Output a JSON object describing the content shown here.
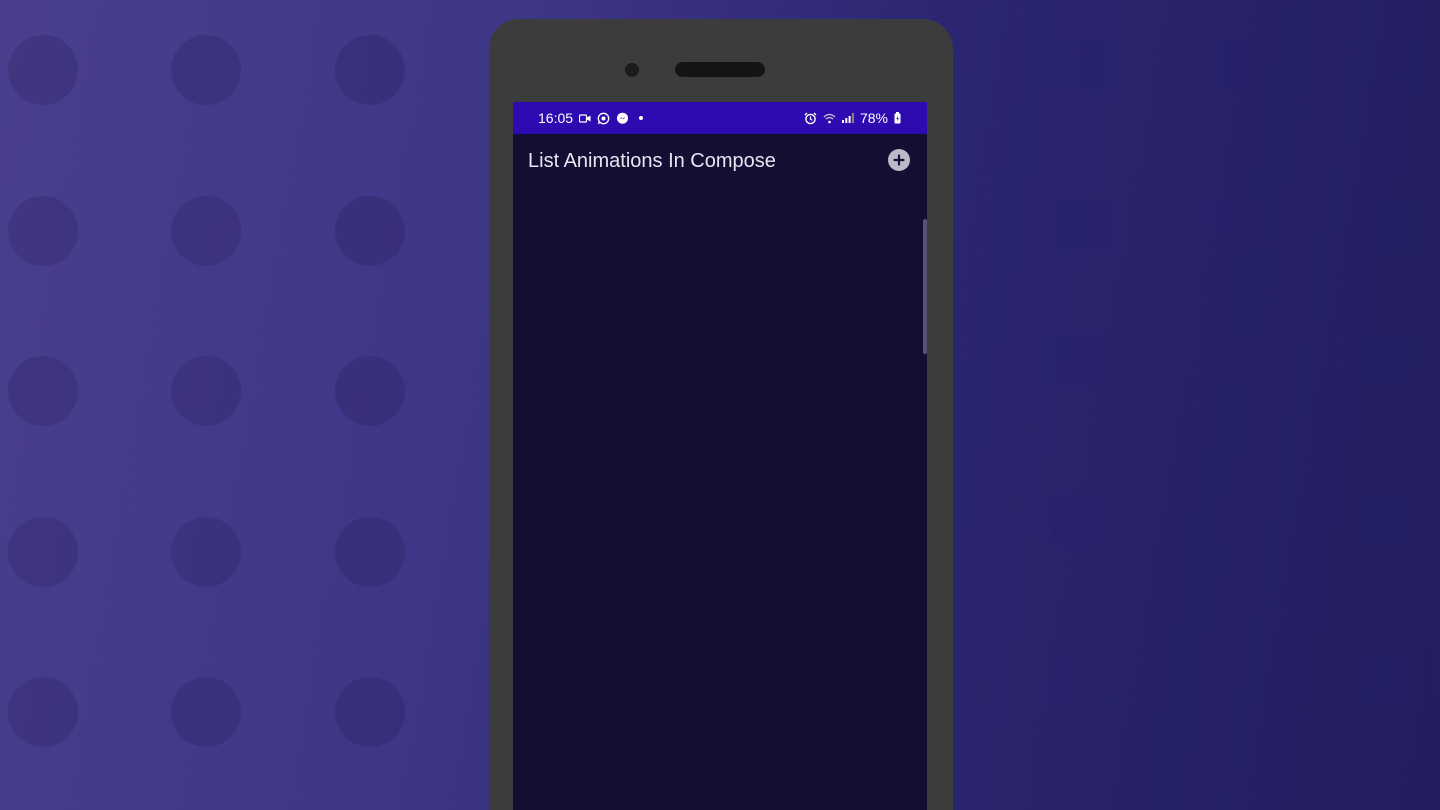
{
  "status_bar": {
    "time": "16:05",
    "battery": "78%",
    "left_icons": [
      "video-camera-icon",
      "whatsapp-icon",
      "messenger-icon"
    ],
    "right_icons": [
      "alarm-icon",
      "wifi-icon",
      "signal-icon",
      "battery-icon"
    ]
  },
  "app_bar": {
    "title": "List Animations In Compose",
    "action_icon": "add-circle-icon"
  },
  "colors": {
    "status_bar": "#2d0bb0",
    "screen_background": "#140e32",
    "title_text": "#e8e6f2",
    "phone_frame": "#3c3c3c"
  }
}
